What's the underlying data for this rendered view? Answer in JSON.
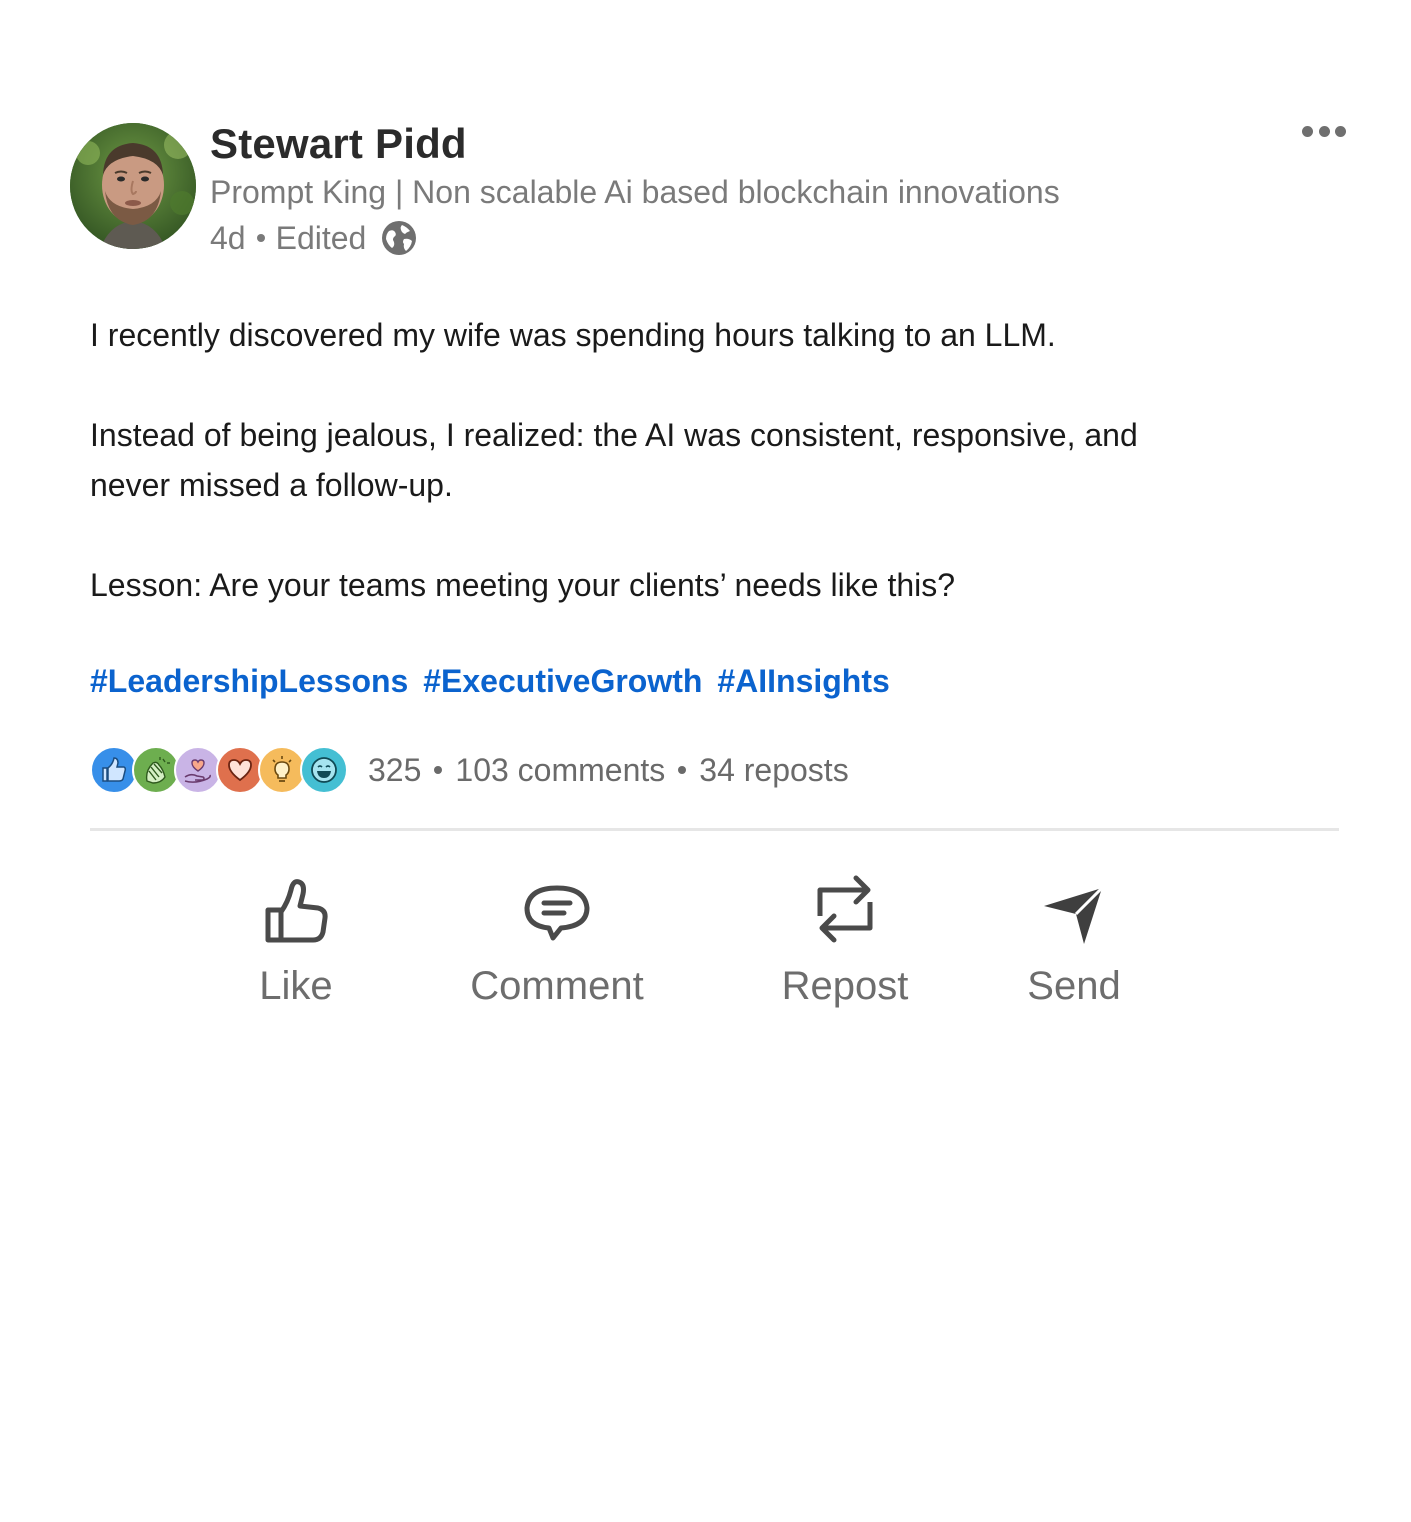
{
  "post": {
    "author": {
      "name": "Stewart Pidd",
      "headline": "Prompt King | Non scalable Ai based blockchain innovations",
      "time": "4d",
      "edited": "Edited",
      "visibility_icon": "globe-icon"
    },
    "more_icon": "ellipsis-icon",
    "body": {
      "p1": "I recently discovered my wife was spending hours talking to an LLM.",
      "p2": "Instead of being jealous, I realized: the AI was consistent, responsive, and never missed a follow-up.",
      "p3": "Lesson: Are your teams meeting your clients’ needs like this?"
    },
    "hashtags": [
      "#LeadershipLessons",
      "#ExecutiveGrowth",
      "#AIInsights"
    ],
    "reactions": {
      "icons": [
        "like-icon",
        "celebrate-icon",
        "support-icon",
        "love-icon",
        "insightful-icon",
        "funny-icon"
      ],
      "count": "325",
      "comments": "103 comments",
      "reposts": "34 reposts"
    },
    "actions": {
      "like": "Like",
      "comment": "Comment",
      "repost": "Repost",
      "send": "Send"
    },
    "colors": {
      "hashtag": "#0b63ce",
      "muted_text": "#7a7a7a",
      "like_blue": "#378fe9",
      "celebrate_green": "#6dae4f",
      "support_purple": "#c9b4e6",
      "love_orange": "#df704d",
      "insightful_yellow": "#f5bb5c",
      "funny_teal": "#44bfd3"
    }
  }
}
